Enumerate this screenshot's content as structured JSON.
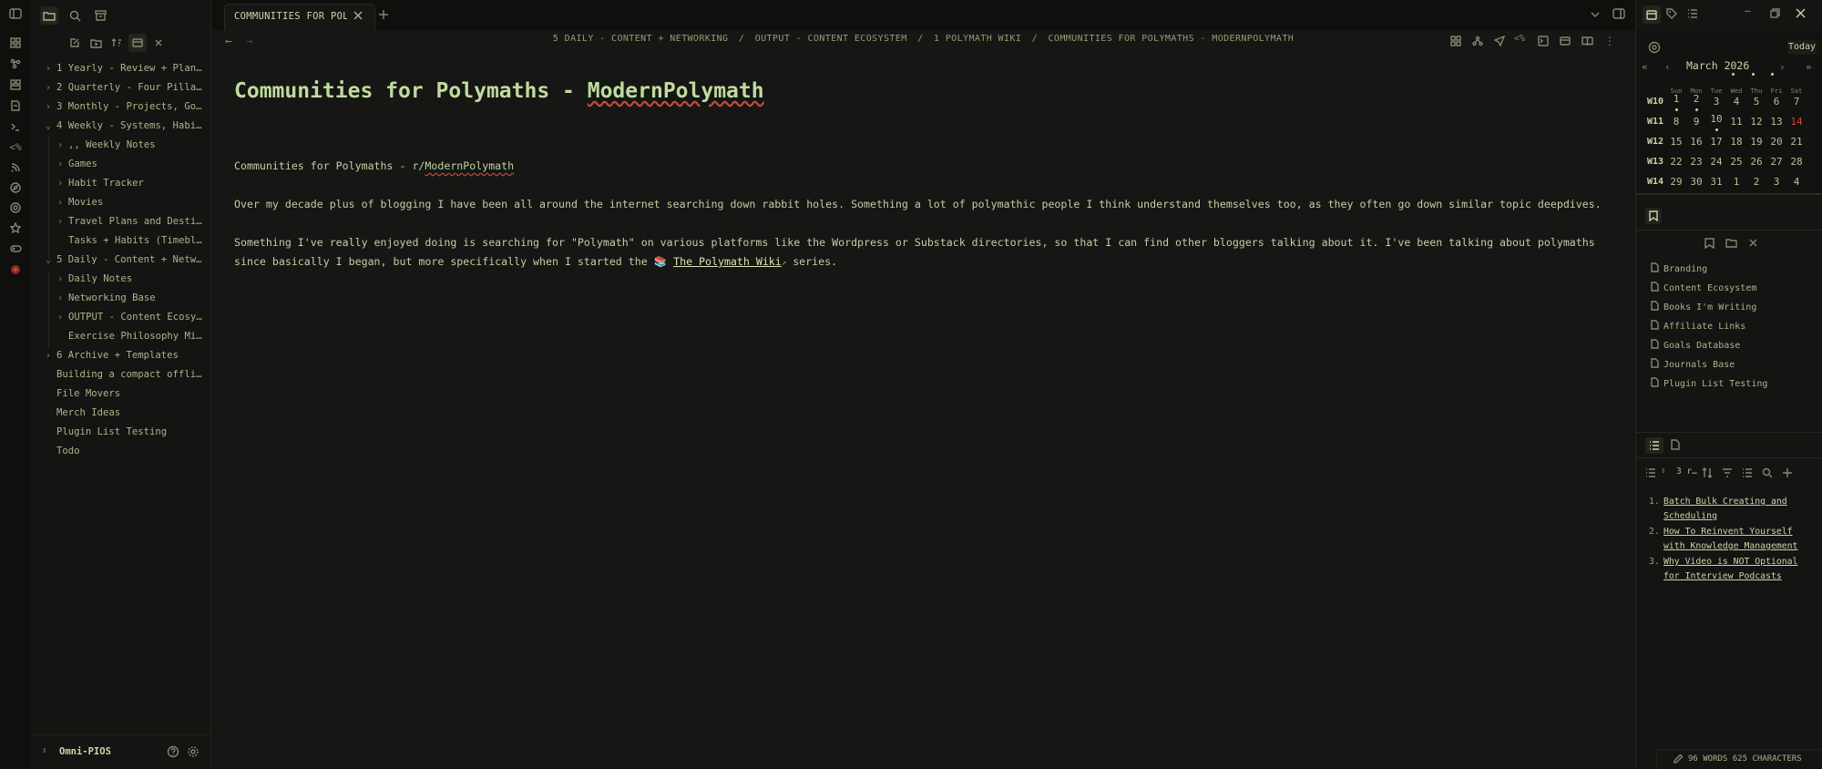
{
  "tab": {
    "title": "COMMUNITIES FOR POLY…"
  },
  "breadcrumb": {
    "items": [
      "5 DAILY - CONTENT + NETWORKING",
      "OUTPUT - CONTENT ECOSYSTEM",
      "1 POLYMATH WIKI",
      "COMMUNITIES FOR POLYMATHS - MODERNPOLYMATH"
    ],
    "sep": "/"
  },
  "note": {
    "title": "Communities for Polymaths - ModernPolymath",
    "subtitle_prefix": "Communities for Polymaths - r/",
    "subtitle_word": "ModernPolymath",
    "para1": "Over my decade plus of blogging I have been all around the internet searching down rabbit holes. Something a lot of polymathic people I think understand themselves too, as they often go down similar topic deepdives.",
    "para2_line1": "Something I've really enjoyed doing is searching for \"Polymath\" on various platforms like the Wordpress or Substack directories, so that I can find other bloggers talking about it. I've been talking about polymaths",
    "para2_line2_prefix": "since basically I began, but more specifically when I started the",
    "link_emoji": "📚",
    "link_text": "The Polymath Wiki",
    "para2_line2_suffix": "series."
  },
  "sidebar": {
    "items": [
      {
        "label": "1 Yearly - Review + Planni…",
        "expandable": true
      },
      {
        "label": "2 Quarterly - Four Pillars…",
        "expandable": true
      },
      {
        "label": "3 Monthly - Projects, Goals",
        "expandable": true
      },
      {
        "label": "4 Weekly - Systems, Habits",
        "expandable": true
      },
      {
        "label": ",, Weekly Notes",
        "expandable": true
      },
      {
        "label": "Games",
        "expandable": true
      },
      {
        "label": "Habit Tracker",
        "expandable": true
      },
      {
        "label": "Movies",
        "expandable": true
      },
      {
        "label": "Travel Plans and Destina…",
        "expandable": true
      },
      {
        "label": "Tasks + Habits (Timebloc…",
        "expandable": false
      },
      {
        "label": "5 Daily - Content + Networ…",
        "expandable": true
      },
      {
        "label": "Daily Notes",
        "expandable": true
      },
      {
        "label": "Networking Base",
        "expandable": true
      },
      {
        "label": "OUTPUT - Content Ecosyst…",
        "expandable": true
      },
      {
        "label": "Exercise Philosophy Mini…",
        "expandable": false
      },
      {
        "label": "6 Archive + Templates",
        "expandable": true
      },
      {
        "label": "Building a compact offline…",
        "expandable": false
      },
      {
        "label": "File Movers",
        "expandable": false
      },
      {
        "label": "Merch Ideas",
        "expandable": false
      },
      {
        "label": "Plugin List Testing",
        "expandable": false
      },
      {
        "label": "Todo",
        "expandable": false
      }
    ],
    "vault_name": "Omni-PIOS"
  },
  "calendar": {
    "month": "March",
    "year": "2026",
    "today_label": "Today",
    "day_headers": [
      "Sun",
      "Mon",
      "Tue",
      "Wed",
      "Thu",
      "Fri",
      "Sat"
    ],
    "weeks": [
      {
        "label": "W10",
        "days": [
          "1",
          "2",
          "3",
          "4",
          "5",
          "6",
          "7"
        ]
      },
      {
        "label": "W11",
        "days": [
          "8",
          "9",
          "10",
          "11",
          "12",
          "13",
          "14"
        ]
      },
      {
        "label": "W12",
        "days": [
          "15",
          "16",
          "17",
          "18",
          "19",
          "20",
          "21"
        ]
      },
      {
        "label": "W13",
        "days": [
          "22",
          "23",
          "24",
          "25",
          "26",
          "27",
          "28"
        ]
      },
      {
        "label": "W14",
        "days": [
          "29",
          "30",
          "31",
          "1",
          "2",
          "3",
          "4"
        ]
      }
    ],
    "today": "14",
    "today_color": "#d24a3a"
  },
  "bookmarks": [
    "Branding",
    "Content Ecosystem",
    "Books I'm Writing",
    "Affiliate Links",
    "Goals Database",
    "Journals Base",
    "Plugin List Testing"
  ],
  "outline": {
    "count_label": "3 r…",
    "items": [
      {
        "num": "1.",
        "line1": "Batch Bulk Creating and",
        "line2": "Scheduling"
      },
      {
        "num": "2.",
        "line1": "How To Reinvent Yourself",
        "line2": "with Knowledge Management"
      },
      {
        "num": "3.",
        "line1": "Why Video is NOT Optional",
        "line2": "for Interview Podcasts"
      }
    ]
  },
  "status": {
    "text": "96 WORDS 625 CHARACTERS"
  },
  "colors": {
    "accent": "#bedc9c",
    "text": "#c2d0a4",
    "background": "#161614"
  }
}
